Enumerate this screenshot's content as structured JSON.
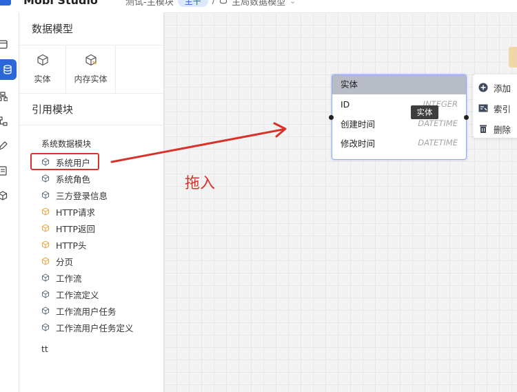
{
  "app": {
    "title": "Mobi Studio"
  },
  "breadcrumb": {
    "module": "测试-主模块",
    "branch": "主干",
    "page": "主局数据模型"
  },
  "panel": {
    "model_title": "数据模型",
    "tools": [
      {
        "label": "实体",
        "icon": "cube-icon"
      },
      {
        "label": "内存实体",
        "icon": "memory-cube-icon"
      }
    ],
    "ref_title": "引用模块",
    "group_title": "系统数据模块",
    "items": [
      {
        "label": "系统用户",
        "color": "#5b6b86"
      },
      {
        "label": "系统角色",
        "color": "#5b6b86"
      },
      {
        "label": "三方登录信息",
        "color": "#5b6b86"
      },
      {
        "label": "HTTP请求",
        "color": "#f0a33a"
      },
      {
        "label": "HTTP返回",
        "color": "#f0a33a"
      },
      {
        "label": "HTTP头",
        "color": "#f0a33a"
      },
      {
        "label": "分页",
        "color": "#f0a33a"
      },
      {
        "label": "工作流",
        "color": "#5b6b86"
      },
      {
        "label": "工作流定义",
        "color": "#5b6b86"
      },
      {
        "label": "工作流用户任务",
        "color": "#5b6b86"
      },
      {
        "label": "工作流用户任务定义",
        "color": "#5b6b86"
      }
    ],
    "tt": "tt"
  },
  "entity": {
    "title": "实体",
    "fields": [
      {
        "name": "ID",
        "type": "INTEGER"
      },
      {
        "name": "创建时间",
        "type": "DATETIME"
      },
      {
        "name": "修改时间",
        "type": "DATETIME"
      }
    ],
    "tooltip": "实体"
  },
  "context_menu": {
    "items": [
      {
        "label": "添加",
        "icon": "plus-circle-icon"
      },
      {
        "label": "索引",
        "icon": "index-icon"
      },
      {
        "label": "删除",
        "icon": "trash-icon"
      }
    ]
  },
  "annotation": {
    "text": "拖入",
    "color": "#d8332a"
  },
  "colors": {
    "accent": "#2b67d8",
    "entity_border": "#8ea6ee",
    "entity_header": "#b7bcc7"
  }
}
